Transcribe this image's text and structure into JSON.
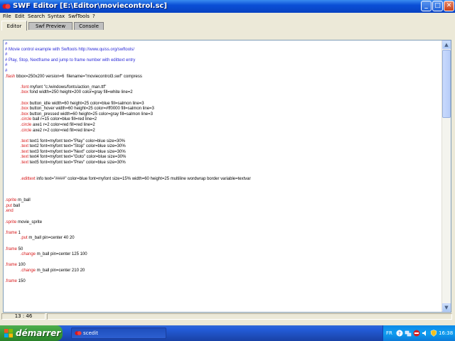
{
  "window": {
    "title": "SWF Editor [E:\\Editor\\moviecontrol.sc]",
    "minimize_glyph": "_",
    "maximize_glyph": "□",
    "close_glyph": "✕"
  },
  "menu": [
    "File",
    "Edit",
    "Search",
    "Syntax",
    "SwfTools",
    "?"
  ],
  "tabs": [
    {
      "label": "Editor",
      "active": true
    },
    {
      "label": "Swf Preview",
      "active": false
    },
    {
      "label": "Console",
      "active": false
    }
  ],
  "code_lines": [
    [
      {
        "t": "#",
        "c": "comment"
      }
    ],
    [
      {
        "t": "# Movie control example with Swftools http://www.quiss.org/swftools/",
        "c": "comment"
      }
    ],
    [
      {
        "t": "#",
        "c": "comment"
      }
    ],
    [
      {
        "t": "# Play, Stop, Nextframe and jump to frame number with edittext entry",
        "c": "comment"
      }
    ],
    [
      {
        "t": "#",
        "c": "comment"
      }
    ],
    [
      {
        "t": "#",
        "c": "comment"
      }
    ],
    [
      {
        "t": ".flash",
        "c": "kw"
      },
      {
        "t": " bbox=250x200 version=6  filename=\"moviecontrol3.swf\" compress",
        "c": ""
      }
    ],
    [],
    [
      {
        "t": "             ",
        "c": ""
      },
      {
        "t": ".font",
        "c": "kw"
      },
      {
        "t": " myfont \"c:/windows/fonts/action_man.ttf\"",
        "c": ""
      }
    ],
    [
      {
        "t": "             ",
        "c": ""
      },
      {
        "t": ".box",
        "c": "kw"
      },
      {
        "t": " fond width=250 height=200 color=gray fill=white line=2",
        "c": ""
      }
    ],
    [],
    [
      {
        "t": "             ",
        "c": ""
      },
      {
        "t": ".box",
        "c": "kw"
      },
      {
        "t": " button_idle width=60 height=25 color=blue fill=salmon line=3",
        "c": ""
      }
    ],
    [
      {
        "t": "             ",
        "c": ""
      },
      {
        "t": ".box",
        "c": "kw"
      },
      {
        "t": " button_hover width=60 height=25 color=#ff0000 fill=salmon line=3",
        "c": ""
      }
    ],
    [
      {
        "t": "             ",
        "c": ""
      },
      {
        "t": ".box",
        "c": "kw"
      },
      {
        "t": " button_pressed width=60 height=25 color=gray fill=salmon line=3",
        "c": ""
      }
    ],
    [
      {
        "t": "             ",
        "c": ""
      },
      {
        "t": ".circle",
        "c": "kw"
      },
      {
        "t": " ball r=15 color=blue fill=red line=2",
        "c": ""
      }
    ],
    [
      {
        "t": "             ",
        "c": ""
      },
      {
        "t": ".circle",
        "c": "kw"
      },
      {
        "t": " axe1 r=2 color=red fill=red line=2",
        "c": ""
      }
    ],
    [
      {
        "t": "             ",
        "c": ""
      },
      {
        "t": ".circle",
        "c": "kw"
      },
      {
        "t": " axe2 r=2 color=red fill=red line=2",
        "c": ""
      }
    ],
    [],
    [
      {
        "t": "             ",
        "c": ""
      },
      {
        "t": ".text",
        "c": "kw"
      },
      {
        "t": " text1 font=myfont text=\"Play\" color=blue size=30%",
        "c": ""
      }
    ],
    [
      {
        "t": "             ",
        "c": ""
      },
      {
        "t": ".text",
        "c": "kw"
      },
      {
        "t": " text2 font=myfont text=\"Stop\" color=blue size=30%",
        "c": ""
      }
    ],
    [
      {
        "t": "             ",
        "c": ""
      },
      {
        "t": ".text",
        "c": "kw"
      },
      {
        "t": " text3 font=myfont text=\"Next\" color=blue size=30%",
        "c": ""
      }
    ],
    [
      {
        "t": "             ",
        "c": ""
      },
      {
        "t": ".text",
        "c": "kw"
      },
      {
        "t": " text4 font=myfont text=\"Goto\" color=blue size=30%",
        "c": ""
      }
    ],
    [
      {
        "t": "             ",
        "c": ""
      },
      {
        "t": ".text",
        "c": "kw"
      },
      {
        "t": " text5 font=myfont text=\"Prev\" color=blue size=30%",
        "c": ""
      }
    ],
    [],
    [],
    [
      {
        "t": "             ",
        "c": ""
      },
      {
        "t": ".edittext",
        "c": "kw"
      },
      {
        "t": " info text=\"####\" color=blue font=myfont size=15% width=60 height=25 multiline wordwrap border variable=textvar",
        "c": ""
      }
    ],
    [],
    [],
    [],
    [
      {
        "t": ".sprite",
        "c": "kw"
      },
      {
        "t": " m_ball",
        "c": ""
      }
    ],
    [
      {
        "t": ".put",
        "c": "kw"
      },
      {
        "t": " ball",
        "c": ""
      }
    ],
    [
      {
        "t": ".end",
        "c": "kw"
      }
    ],
    [],
    [
      {
        "t": ".sprite",
        "c": "kw"
      },
      {
        "t": " movie_sprite",
        "c": ""
      }
    ],
    [],
    [
      {
        "t": ".frame",
        "c": "kw"
      },
      {
        "t": " 1",
        "c": ""
      }
    ],
    [
      {
        "t": "             ",
        "c": ""
      },
      {
        "t": ".put",
        "c": "kw"
      },
      {
        "t": " m_ball pin=center 40 20",
        "c": ""
      }
    ],
    [],
    [
      {
        "t": ".frame",
        "c": "kw"
      },
      {
        "t": " 50",
        "c": ""
      }
    ],
    [
      {
        "t": "             ",
        "c": ""
      },
      {
        "t": ".change",
        "c": "kw"
      },
      {
        "t": " m_ball pin=center 125 100",
        "c": ""
      }
    ],
    [],
    [
      {
        "t": ".frame",
        "c": "kw"
      },
      {
        "t": " 100",
        "c": ""
      }
    ],
    [
      {
        "t": "             ",
        "c": ""
      },
      {
        "t": ".change",
        "c": "kw"
      },
      {
        "t": " m_ball pin=center 210 20",
        "c": ""
      }
    ],
    [],
    [
      {
        "t": ".frame",
        "c": "kw"
      },
      {
        "t": " 150",
        "c": ""
      }
    ]
  ],
  "status": {
    "cursor": "13 : 46"
  },
  "taskbar": {
    "start_label": "démarrer",
    "task_label": "scedit",
    "language": "FR",
    "clock": "16:38"
  },
  "colors": {
    "comment": "#2b2bd8",
    "keyword": "#d8181a"
  }
}
